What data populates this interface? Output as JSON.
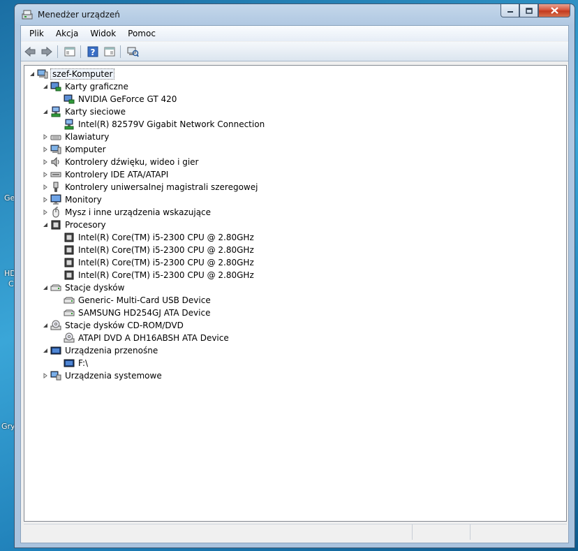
{
  "window": {
    "title": "Menedżer urządzeń"
  },
  "menu": [
    "Plik",
    "Akcja",
    "Widok",
    "Pomoc"
  ],
  "toolbar": [
    "back-icon",
    "forward-icon",
    "properties-panel-icon",
    "help-icon",
    "details-view-icon",
    "scan-hardware-icon"
  ],
  "desktop_fragments": [
    "Ge",
    "HD",
    "C",
    "Gry"
  ],
  "tree": {
    "root": "szef-Komputer",
    "categories": [
      {
        "label": "Karty graficzne",
        "expanded": true,
        "icon": "display-adapter-icon",
        "children": [
          {
            "label": "NVIDIA GeForce GT 420",
            "icon": "display-adapter-icon"
          }
        ]
      },
      {
        "label": "Karty sieciowe",
        "expanded": true,
        "icon": "network-adapter-icon",
        "children": [
          {
            "label": "Intel(R) 82579V Gigabit Network Connection",
            "icon": "network-adapter-icon"
          }
        ]
      },
      {
        "label": "Klawiatury",
        "expanded": false,
        "icon": "keyboard-icon",
        "children": []
      },
      {
        "label": "Komputer",
        "expanded": false,
        "icon": "computer-icon",
        "children": []
      },
      {
        "label": "Kontrolery dźwięku, wideo i gier",
        "expanded": false,
        "icon": "speaker-icon",
        "children": []
      },
      {
        "label": "Kontrolery IDE ATA/ATAPI",
        "expanded": false,
        "icon": "ide-controller-icon",
        "children": []
      },
      {
        "label": "Kontrolery uniwersalnej magistrali szeregowej",
        "expanded": false,
        "icon": "usb-icon",
        "children": []
      },
      {
        "label": "Monitory",
        "expanded": false,
        "icon": "monitor-icon",
        "children": []
      },
      {
        "label": "Mysz i inne urządzenia wskazujące",
        "expanded": false,
        "icon": "mouse-icon",
        "children": []
      },
      {
        "label": "Procesory",
        "expanded": true,
        "icon": "processor-icon",
        "children": [
          {
            "label": "Intel(R) Core(TM) i5-2300 CPU @ 2.80GHz",
            "icon": "processor-icon"
          },
          {
            "label": "Intel(R) Core(TM) i5-2300 CPU @ 2.80GHz",
            "icon": "processor-icon"
          },
          {
            "label": "Intel(R) Core(TM) i5-2300 CPU @ 2.80GHz",
            "icon": "processor-icon"
          },
          {
            "label": "Intel(R) Core(TM) i5-2300 CPU @ 2.80GHz",
            "icon": "processor-icon"
          }
        ]
      },
      {
        "label": "Stacje dysków",
        "expanded": true,
        "icon": "disk-drive-icon",
        "children": [
          {
            "label": "Generic- Multi-Card USB Device",
            "icon": "disk-drive-icon"
          },
          {
            "label": "SAMSUNG HD254GJ ATA Device",
            "icon": "disk-drive-icon"
          }
        ]
      },
      {
        "label": "Stacje dysków CD-ROM/DVD",
        "expanded": true,
        "icon": "cdrom-icon",
        "children": [
          {
            "label": "ATAPI DVD A  DH16ABSH ATA Device",
            "icon": "cdrom-icon"
          }
        ]
      },
      {
        "label": "Urządzenia przenośne",
        "expanded": true,
        "icon": "portable-device-icon",
        "children": [
          {
            "label": "F:\\",
            "icon": "portable-device-icon"
          }
        ]
      },
      {
        "label": "Urządzenia systemowe",
        "expanded": false,
        "icon": "system-device-icon",
        "children": []
      }
    ]
  }
}
